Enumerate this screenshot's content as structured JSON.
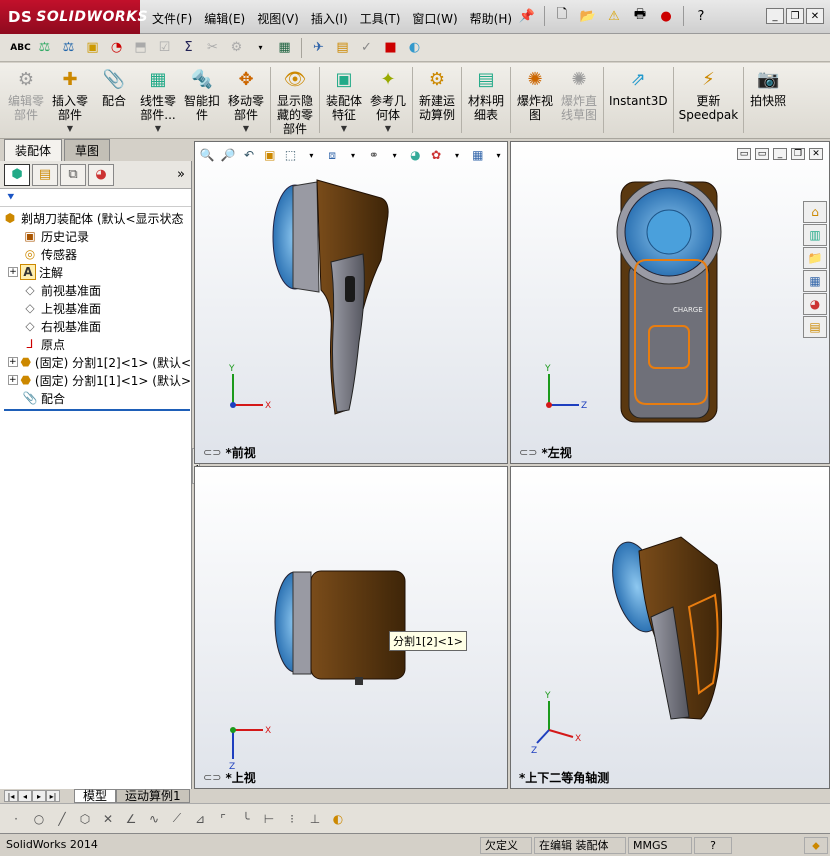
{
  "app": {
    "logo_prefix": "DS",
    "logo_text": "SOLIDWORKS"
  },
  "menu": [
    "文件(F)",
    "编辑(E)",
    "视图(V)",
    "插入(I)",
    "工具(T)",
    "窗口(W)",
    "帮助(H)"
  ],
  "quick_toolbar_icons": [
    "pin-icon",
    "new-document-icon",
    "open-icon",
    "rebuild-icon",
    "print-icon",
    "traffic-light-icon",
    "help-icon"
  ],
  "command_manager": [
    {
      "label": "编辑零\n部件",
      "icon": "edit-component-icon",
      "enabled": false,
      "dropdown": false
    },
    {
      "label": "插入零\n部件",
      "icon": "insert-component-icon",
      "enabled": true,
      "dropdown": true
    },
    {
      "label": "配合",
      "icon": "mate-icon",
      "enabled": true,
      "dropdown": false
    },
    {
      "label": "线性零\n部件...",
      "icon": "linear-pattern-icon",
      "enabled": true,
      "dropdown": true
    },
    {
      "label": "智能扣\n件",
      "icon": "smart-fastener-icon",
      "enabled": true,
      "dropdown": false
    },
    {
      "label": "移动零\n部件",
      "icon": "move-component-icon",
      "enabled": true,
      "dropdown": true
    },
    {
      "label": "显示隐\n藏的零\n部件",
      "icon": "show-hidden-icon",
      "enabled": true,
      "dropdown": false
    },
    {
      "label": "装配体\n特征",
      "icon": "assembly-feature-icon",
      "enabled": true,
      "dropdown": true
    },
    {
      "label": "参考几\n何体",
      "icon": "reference-geometry-icon",
      "enabled": true,
      "dropdown": true
    },
    {
      "label": "新建运\n动算例",
      "icon": "motion-study-icon",
      "enabled": true,
      "dropdown": false
    },
    {
      "label": "材料明\n细表",
      "icon": "bom-icon",
      "enabled": true,
      "dropdown": false
    },
    {
      "label": "爆炸视\n图",
      "icon": "exploded-view-icon",
      "enabled": true,
      "dropdown": false
    },
    {
      "label": "爆炸直\n线草图",
      "icon": "explode-line-icon",
      "enabled": false,
      "dropdown": false
    },
    {
      "label": "Instant3D",
      "icon": "instant3d-icon",
      "enabled": true,
      "dropdown": false
    },
    {
      "label": "更新\nSpeedpak",
      "icon": "speedpak-icon",
      "enabled": true,
      "dropdown": false
    },
    {
      "label": "拍快照",
      "icon": "snapshot-icon",
      "enabled": true,
      "dropdown": false
    }
  ],
  "cmd_tabs": [
    "装配体",
    "草图"
  ],
  "panel_tabs": [
    "feature-manager-icon",
    "property-manager-icon",
    "configuration-manager-icon",
    "display-manager-icon"
  ],
  "tree": [
    {
      "label": "剃胡刀装配体 (默认<显示状态",
      "icon": "assembly-icon",
      "indent": 0,
      "expand": ""
    },
    {
      "label": "历史记录",
      "icon": "history-icon",
      "indent": 1,
      "expand": ""
    },
    {
      "label": "传感器",
      "icon": "sensor-icon",
      "indent": 1,
      "expand": ""
    },
    {
      "label": "注解",
      "icon": "annotation-icon",
      "indent": 1,
      "expand": "+"
    },
    {
      "label": "前视基准面",
      "icon": "plane-icon",
      "indent": 1,
      "expand": ""
    },
    {
      "label": "上视基准面",
      "icon": "plane-icon",
      "indent": 1,
      "expand": ""
    },
    {
      "label": "右视基准面",
      "icon": "plane-icon",
      "indent": 1,
      "expand": ""
    },
    {
      "label": "原点",
      "icon": "origin-icon",
      "indent": 1,
      "expand": ""
    },
    {
      "label": "(固定) 分割1[2]<1> (默认<",
      "icon": "part-icon",
      "indent": 1,
      "expand": "+"
    },
    {
      "label": "(固定) 分割1[1]<1> (默认>",
      "icon": "part-icon",
      "indent": 1,
      "expand": "+"
    },
    {
      "label": "配合",
      "icon": "mates-icon",
      "indent": 1,
      "expand": ""
    }
  ],
  "bottom_tabs": [
    "模型",
    "运动算例1"
  ],
  "viewports": {
    "tl": "*前视",
    "tr": "*左视",
    "bl": "*上视",
    "br": "*上下二等角轴测"
  },
  "tooltip": "分割1[2]<1>",
  "model_text": "CHARGE",
  "status": {
    "app": "SolidWorks 2014",
    "state": "欠定义",
    "editing": "在编辑 装配体",
    "units": "MMGS"
  },
  "colors": {
    "body_brown": "#5e3a12",
    "body_gray": "#6f7079",
    "blade_blue": "#3d8fd4",
    "highlight_orange": "#e87d10",
    "axis_x": "#d41818",
    "axis_y": "#1c9a1c",
    "axis_z": "#1e3fbf"
  }
}
